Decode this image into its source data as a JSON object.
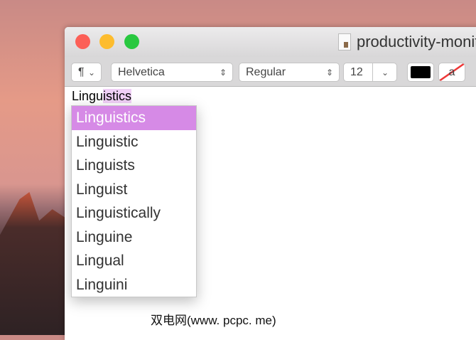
{
  "window": {
    "title": "productivity-monit"
  },
  "toolbar": {
    "paragraph": "¶",
    "font": "Helvetica",
    "style": "Regular",
    "size": "12",
    "text_color": "#000000",
    "highlight_label": "a"
  },
  "document": {
    "typed_prefix": "Lingu",
    "typed_suffix": "istics"
  },
  "autocomplete": {
    "items": [
      "Linguistics",
      "Linguistic",
      "Linguists",
      "Linguist",
      "Linguistically",
      "Linguine",
      "Lingual",
      "Linguini"
    ],
    "selected_color": "#d68ae6"
  },
  "watermark": "双电网(www. pcpc. me)"
}
